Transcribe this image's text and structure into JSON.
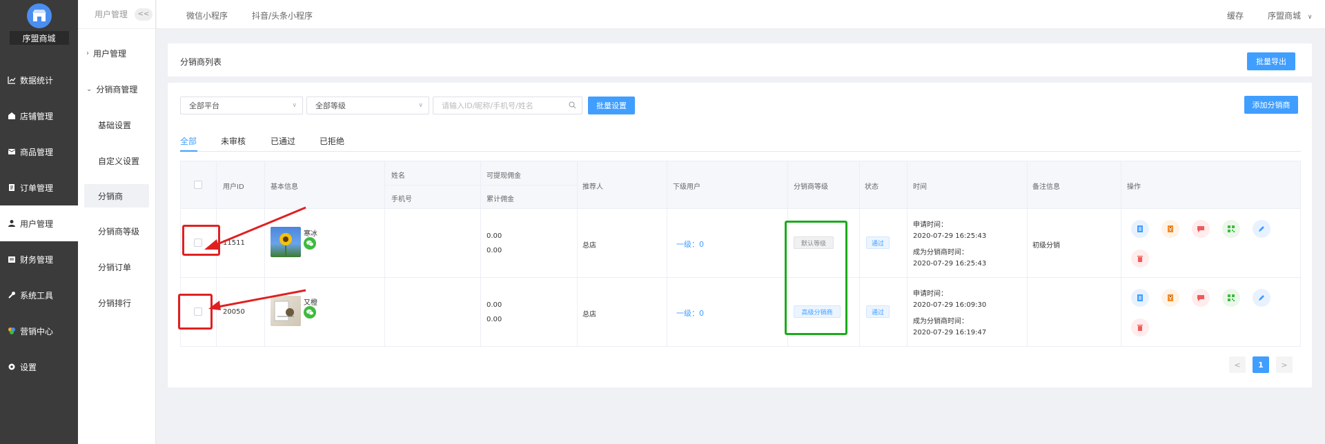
{
  "brand": {
    "name": "序盟商城"
  },
  "sidebar": {
    "items": [
      {
        "label": "数据统计",
        "icon": "chart-line-icon"
      },
      {
        "label": "店铺管理",
        "icon": "store-icon"
      },
      {
        "label": "商品管理",
        "icon": "goods-icon"
      },
      {
        "label": "订单管理",
        "icon": "order-icon"
      },
      {
        "label": "用户管理",
        "icon": "user-icon",
        "active": true
      },
      {
        "label": "财务管理",
        "icon": "finance-icon"
      },
      {
        "label": "系统工具",
        "icon": "wrench-icon"
      },
      {
        "label": "营销中心",
        "icon": "marketing-icon"
      },
      {
        "label": "设置",
        "icon": "gear-icon"
      }
    ]
  },
  "subnav": {
    "header": "用户管理",
    "collapse": "<<",
    "group1": "用户管理",
    "group2": "分销商管理",
    "items": [
      "基础设置",
      "自定义设置",
      "分销商",
      "分销商等级",
      "分销订单",
      "分销排行"
    ]
  },
  "topnav": {
    "links": [
      "微信小程序",
      "抖音/头条小程序"
    ],
    "cache": "缓存",
    "store": "序盟商城"
  },
  "header_card": {
    "title": "分销商列表",
    "export_button": "批量导出"
  },
  "filters": {
    "platform": "全部平台",
    "level": "全部等级",
    "search_placeholder": "请输入ID/昵称/手机号/姓名",
    "batch_button": "批量设置",
    "add_button": "添加分销商"
  },
  "tabs": [
    "全部",
    "未审核",
    "已通过",
    "已拒绝"
  ],
  "table": {
    "headers": {
      "user_id": "用户ID",
      "basic": "基本信息",
      "name": "姓名",
      "phone": "手机号",
      "withdrawable": "可提现佣金",
      "accumulated": "累计佣金",
      "referrer": "推荐人",
      "downline": "下级用户",
      "level": "分销商等级",
      "status": "状态",
      "time": "时间",
      "remark": "备注信息",
      "ops": "操作"
    },
    "rows": [
      {
        "id": "11511",
        "nickname": "寒冰",
        "withdrawable": "0.00",
        "accumulated": "0.00",
        "referrer": "总店",
        "downline": "一级：0",
        "level": "默认等级",
        "status": "通过",
        "apply_label": "申请时间：",
        "apply_time": "2020-07-29 16:25:43",
        "become_label": "成为分销商时间：",
        "become_time": "2020-07-29 16:25:43",
        "remark": "初级分销"
      },
      {
        "id": "20050",
        "nickname": "又橙",
        "withdrawable": "0.00",
        "accumulated": "0.00",
        "referrer": "总店",
        "downline": "一级：0",
        "level": "高级分销商",
        "status": "通过",
        "apply_label": "申请时间：",
        "apply_time": "2020-07-29 16:09:30",
        "become_label": "成为分销商时间：",
        "become_time": "2020-07-29 16:19:47",
        "remark": ""
      }
    ]
  },
  "pagination": {
    "current": "1",
    "prev": "<",
    "next": ">"
  },
  "colors": {
    "accent": "#409eff",
    "sidebar": "#3b3b3b",
    "annotation_red": "#e02020",
    "annotation_green": "#1aaa1a"
  }
}
